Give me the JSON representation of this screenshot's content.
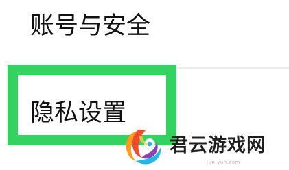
{
  "menu": {
    "items": [
      {
        "label": "账号与安全"
      },
      {
        "label": "隐私设置"
      }
    ]
  },
  "highlight": {
    "color": "#34d261"
  },
  "watermark": {
    "name": "君云游戏网",
    "domain": "jun-yun.com",
    "logo_icon": "colorful-swirl-logo-icon",
    "logo_colors": [
      "#f04b2e",
      "#ff9a1f",
      "#23b6e8",
      "#8e44ad"
    ]
  }
}
